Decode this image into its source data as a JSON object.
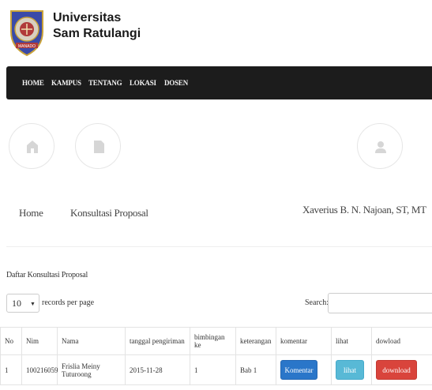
{
  "brand": {
    "line1": "Universitas",
    "line2": "Sam Ratulangi",
    "logo_text": "MANADO"
  },
  "nav": {
    "items": [
      "HOME",
      "KAMPUS",
      "TENTANG",
      "LOKASI",
      "DOSEN"
    ]
  },
  "quicklinks": {
    "home": "Home",
    "konsultasi": "Konsultasi Proposal",
    "user": "Xaverius B. N. Najoan, ST, MT"
  },
  "section": {
    "title": "Daftar Konsultasi Proposal"
  },
  "table_controls": {
    "length_value": "10",
    "length_label": "records per page",
    "search_label": "Search:"
  },
  "table": {
    "headers": [
      "No",
      "Nim",
      "Nama",
      "tanggal pengiriman",
      "bimbingan ke",
      "keterangan",
      "komentar",
      "lihat",
      "dowload"
    ],
    "rows": [
      {
        "no": "1",
        "nim": "100216059",
        "nama": "Frislia Meiny Tuturoong",
        "tanggal": "2015-11-28",
        "bimbingan": "1",
        "keterangan": "Bab 1",
        "komentar_btn": "Komentar",
        "lihat_btn": "lihat",
        "download_btn": "download"
      }
    ]
  },
  "colors": {
    "navbar": "#1c1c1c",
    "btn_komentar": "#2a76c9",
    "btn_lihat": "#58b9d6",
    "btn_download": "#d9443c"
  }
}
